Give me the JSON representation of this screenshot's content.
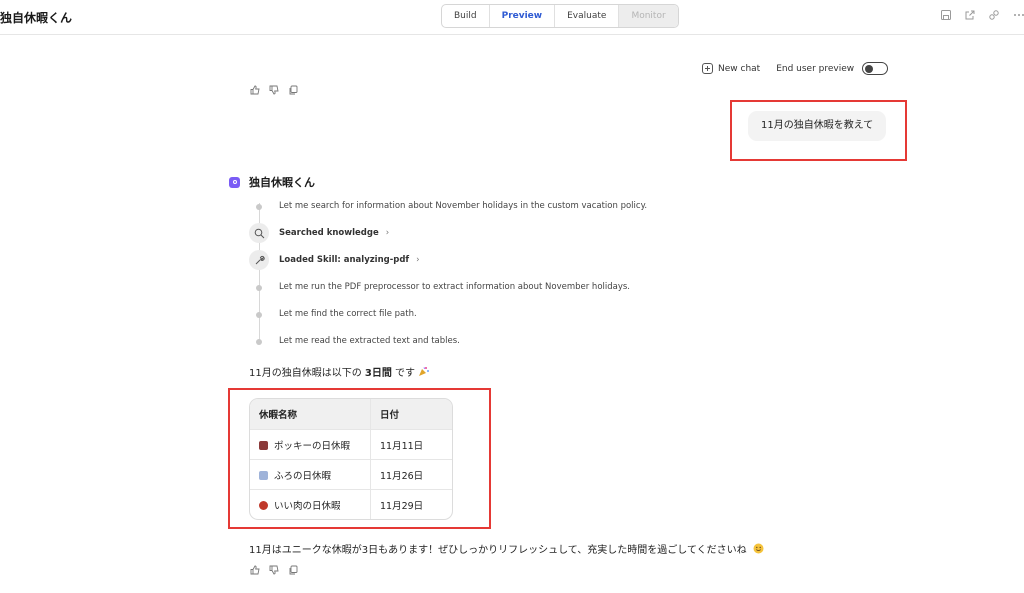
{
  "app": {
    "title": "独自休暇くん"
  },
  "tabs": [
    {
      "label": "Build",
      "state": "normal"
    },
    {
      "label": "Preview",
      "state": "active"
    },
    {
      "label": "Evaluate",
      "state": "normal"
    },
    {
      "label": "Monitor",
      "state": "disabled"
    }
  ],
  "top_icons": [
    "save-icon",
    "share-icon",
    "settings-icon",
    "more-icon"
  ],
  "chat_controls": {
    "new_chat_label": "New chat",
    "end_user_preview_label": "End user preview",
    "toggle_on": false
  },
  "user_message": "11月の独自休暇を教えて",
  "bot": {
    "name": "独自休暇くん",
    "avatar_color": "#7a5cf5"
  },
  "steps": [
    {
      "text": "Let me search for information about November holidays in the custom vacation policy."
    },
    {
      "action": "Searched knowledge",
      "icon": "search-icon"
    },
    {
      "action": "Loaded Skill: analyzing-pdf",
      "icon": "wrench-icon"
    },
    {
      "text": "Let me run the PDF preprocessor to extract information about November holidays."
    },
    {
      "text": "Let me find the correct file path."
    },
    {
      "text": "Let me read the extracted text and tables."
    }
  ],
  "answer": {
    "prefix": "11月の独自休暇は以下の ",
    "bold": "3日間",
    "suffix": " です",
    "emoji": "party-popper"
  },
  "table": {
    "headers": [
      "休暇名称",
      "日付"
    ],
    "rows": [
      {
        "icon": "pocky-icon",
        "icon_color": "#8b3a3a",
        "name": "ポッキーの日休暇",
        "date": "11月11日"
      },
      {
        "icon": "bath-icon",
        "icon_color": "#9fb3d9",
        "name": "ふろの日休暇",
        "date": "11月26日"
      },
      {
        "icon": "meat-icon",
        "icon_color": "#c0392b",
        "name": "いい肉の日休暇",
        "date": "11月29日"
      }
    ]
  },
  "closing": "11月はユニークな休暇が3日もあります！ぜひしっかりリフレッシュして、充実した時間を過ごしてくださいね",
  "highlight_color": "#e53935"
}
